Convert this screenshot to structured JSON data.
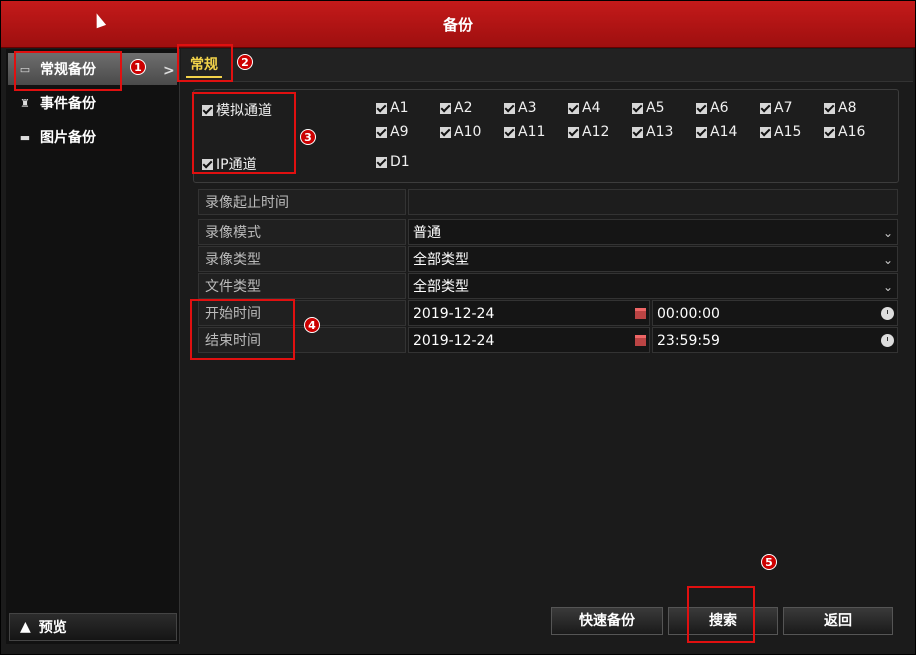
{
  "window": {
    "title": "备份"
  },
  "sidebar": {
    "items": [
      {
        "label": "常规备份",
        "icon": "folder-icon"
      },
      {
        "label": "事件备份",
        "icon": "pin-icon"
      },
      {
        "label": "图片备份",
        "icon": "image-icon"
      }
    ],
    "arrow": ">",
    "preview_label": "预览"
  },
  "tabs": [
    {
      "label": "常规"
    }
  ],
  "channels": {
    "analog_label": "模拟通道",
    "ip_label": "IP通道",
    "analog": [
      "A1",
      "A2",
      "A3",
      "A4",
      "A5",
      "A6",
      "A7",
      "A8",
      "A9",
      "A10",
      "A11",
      "A12",
      "A13",
      "A14",
      "A15",
      "A16"
    ],
    "ip": [
      "D1"
    ]
  },
  "form": {
    "record_time_label": "录像起止时间",
    "mode_label": "录像模式",
    "mode_value": "普通",
    "rec_type_label": "录像类型",
    "rec_type_value": "全部类型",
    "file_type_label": "文件类型",
    "file_type_value": "全部类型",
    "start_label": "开始时间",
    "start_date": "2019-12-24",
    "start_time": "00:00:00",
    "end_label": "结束时间",
    "end_date": "2019-12-24",
    "end_time": "23:59:59"
  },
  "buttons": {
    "quick_backup": "快速备份",
    "search": "搜索",
    "back": "返回"
  },
  "annotations": [
    "1",
    "2",
    "3",
    "4",
    "5"
  ],
  "colors": {
    "titlebar": "#b81414",
    "accent_tab": "#f3d34a",
    "marker": "#e01010"
  }
}
